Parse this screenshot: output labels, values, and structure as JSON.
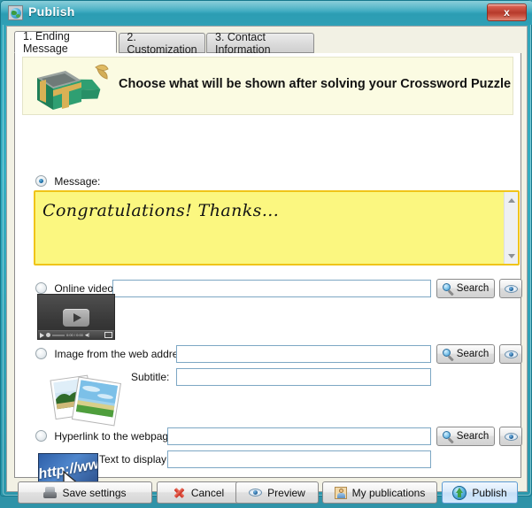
{
  "window": {
    "title": "Publish",
    "title_icon": "globe-icon",
    "close_label": "x",
    "frame_color": "#2fa3b8"
  },
  "tabs": [
    {
      "label": "1. Ending Message",
      "active": true
    },
    {
      "label": "2. Customization",
      "active": false
    },
    {
      "label": "3. Contact Information",
      "active": false
    }
  ],
  "banner": {
    "icon": "gift-box-icon",
    "text": "Choose what will be shown after solving your Crossword Puzzle",
    "background": "#fbfbe2"
  },
  "options": {
    "message": {
      "label": "Message:",
      "selected": true,
      "text": "Congratulations! Thanks...",
      "background": "#fbf780",
      "border": "#f0c419"
    },
    "video": {
      "label": "Online video:",
      "selected": false,
      "url_value": "",
      "search_label": "Search",
      "thumbnail": "video-player-thumbnail",
      "player_time": "0:00 / 0:00"
    },
    "image": {
      "label": "Image from the web address:",
      "selected": false,
      "url_value": "",
      "subtitle_label": "Subtitle:",
      "subtitle_value": "",
      "search_label": "Search",
      "thumbnail": "photos-thumbnail"
    },
    "hyperlink": {
      "label": "Hyperlink to the webpage:",
      "selected": false,
      "url_value": "",
      "text_label": "Text to display:",
      "text_value": "",
      "search_label": "Search",
      "thumbnail": "http-link-thumbnail",
      "thumbnail_text": "http://www"
    }
  },
  "footer": {
    "buttons": [
      {
        "label": "Save settings",
        "icon": "save-icon",
        "primary": false
      },
      {
        "label": "Cancel",
        "icon": "cancel-x-icon",
        "primary": false
      },
      {
        "label": "Preview",
        "icon": "eye-icon",
        "primary": false
      },
      {
        "label": "My publications",
        "icon": "person-icon",
        "primary": false
      },
      {
        "label": "Publish",
        "icon": "globe-upload-icon",
        "primary": true
      }
    ]
  }
}
